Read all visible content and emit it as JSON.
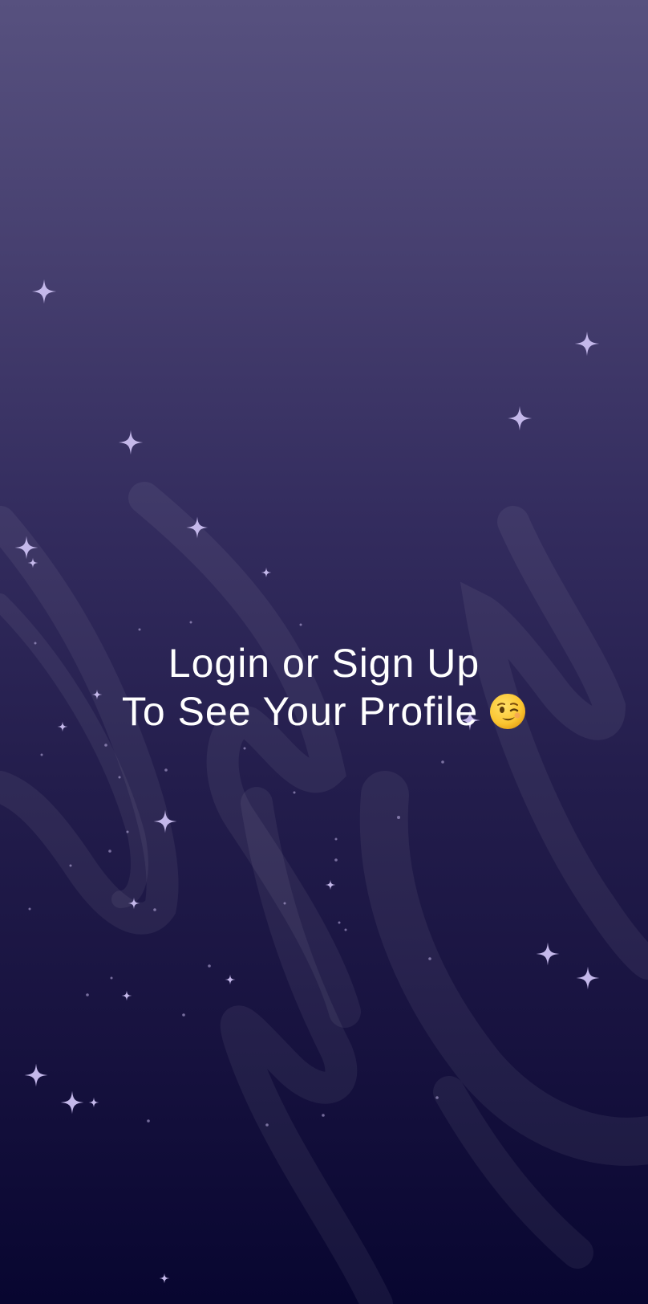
{
  "message": {
    "line1": "Login or Sign Up",
    "line2": "To See Your Profile"
  },
  "icons": {
    "emoji": "winking-face-icon",
    "decoration": "sparkle-icon"
  },
  "colors": {
    "background_top": "#57517f",
    "background_bottom": "#080630",
    "text": "#ffffff",
    "sparkle": "#c4b8ea"
  }
}
